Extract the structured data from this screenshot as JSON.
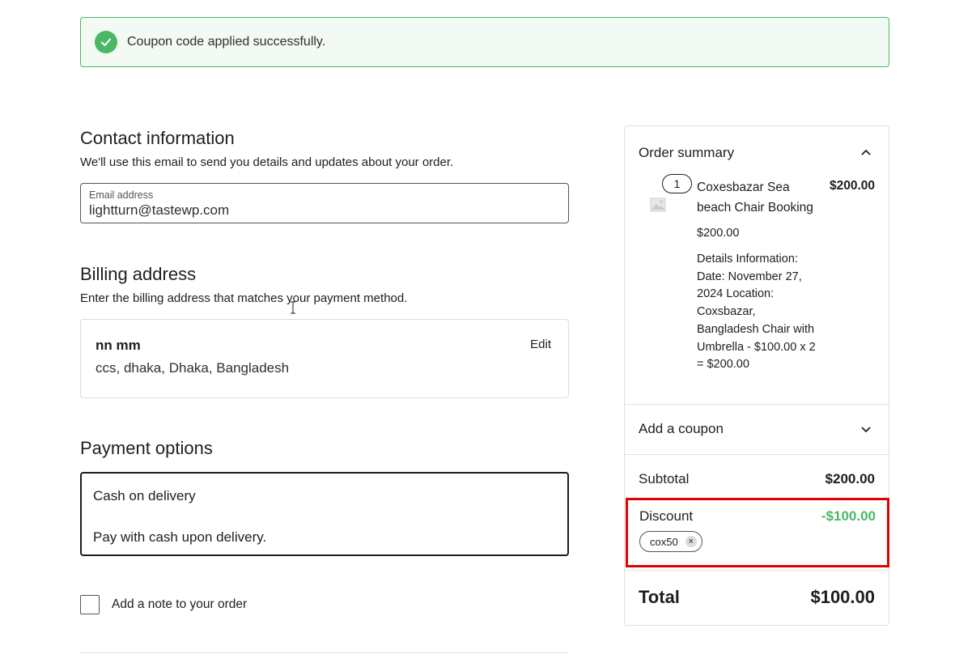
{
  "notice": {
    "message": "Coupon code applied successfully."
  },
  "contact": {
    "title": "Contact information",
    "description": "We'll use this email to send you details and updates about your order.",
    "email_label": "Email address",
    "email_value": "lightturn@tastewp.com"
  },
  "billing": {
    "title": "Billing address",
    "description": "Enter the billing address that matches your payment method.",
    "name": "nn mm",
    "address": "ccs, dhaka, Dhaka, Bangladesh",
    "edit_label": "Edit"
  },
  "payment": {
    "title": "Payment options",
    "method": "Cash on delivery",
    "description": "Pay with cash upon delivery."
  },
  "note": {
    "label": "Add a note to your order"
  },
  "order_summary": {
    "title": "Order summary",
    "item": {
      "quantity": "1",
      "name": "Coxesbazar Sea beach Chair Booking",
      "line_total": "$200.00",
      "unit_price": "$200.00",
      "details": "Details Information: Date: November 27, 2024 Location: Coxsbazar, Bangladesh Chair with Umbrella - $100.00 x 2 = $200.00"
    },
    "coupon_label": "Add a coupon",
    "subtotal_label": "Subtotal",
    "subtotal_value": "$200.00",
    "discount_label": "Discount",
    "discount_value": "-$100.00",
    "coupon_code": "cox50",
    "total_label": "Total",
    "total_value": "$100.00"
  },
  "colors": {
    "success": "#4ab866",
    "highlight": "#e00000",
    "text": "#1e1e1e"
  }
}
